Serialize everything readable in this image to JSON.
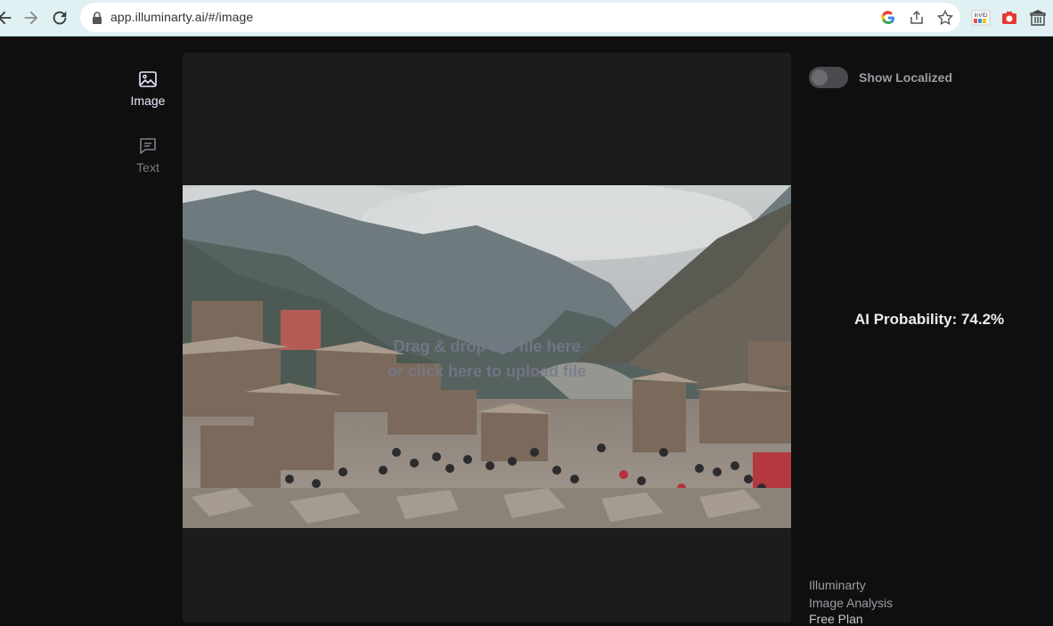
{
  "browser": {
    "url": "app.illuminarty.ai/#/image",
    "icons": {
      "back": "arrow-left-icon",
      "forward": "arrow-right-icon",
      "reload": "reload-icon",
      "lock": "lock-icon",
      "google": "google-icon",
      "share": "share-icon",
      "bookmark": "star-icon",
      "invid": "invid-extension-icon",
      "camera": "camera-extension-icon",
      "archive": "archive-extension-icon"
    }
  },
  "sidenav": {
    "items": [
      {
        "label": "Image",
        "icon": "image-icon",
        "active": true
      },
      {
        "label": "Text",
        "icon": "chat-icon",
        "active": false
      }
    ]
  },
  "upload": {
    "line1": "Drag & drop the file here",
    "line2": "or click here to upload file"
  },
  "toggle": {
    "label": "Show Localized",
    "on": false
  },
  "result": {
    "ai_probability": "AI Probability: 74.2%"
  },
  "footer": {
    "line1": "Illuminarty",
    "line2": "Image Analysis",
    "line3": "Free Plan"
  },
  "colors": {
    "chrome_bg": "#dff1f3",
    "app_bg": "#0f0f10",
    "panel_bg": "#1c1c1f",
    "accent": "#e9e9ff"
  }
}
